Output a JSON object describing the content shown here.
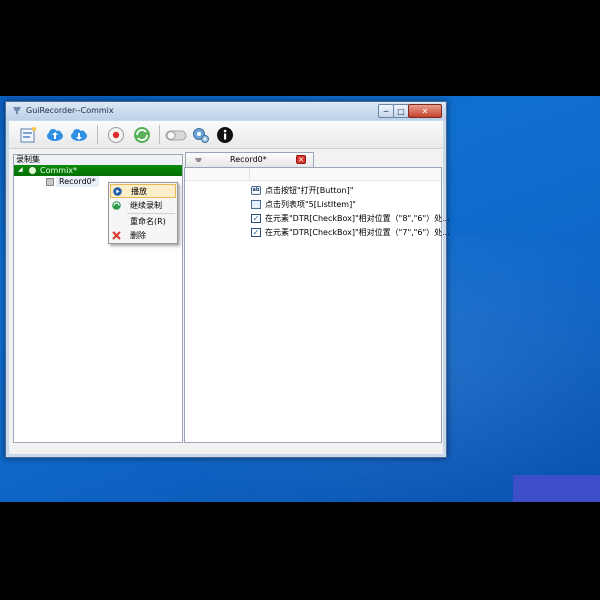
{
  "window": {
    "title": "GuiRecorder--Commix",
    "minimize_label": "─",
    "maximize_label": "□",
    "close_label": "✕"
  },
  "toolbar": {
    "buttons": [
      {
        "icon": "new-record-icon"
      },
      {
        "icon": "cloud-upload-icon"
      },
      {
        "icon": "cloud-download-icon"
      },
      {
        "icon": "record-button-icon"
      },
      {
        "icon": "refresh-icon"
      },
      {
        "icon": "toggle-switch-icon"
      },
      {
        "icon": "settings-gears-icon"
      },
      {
        "icon": "info-icon"
      }
    ]
  },
  "left_pane": {
    "header": "录制集",
    "root_expander": "◢",
    "root_label": "Commix*",
    "child_label": "Record0*"
  },
  "editor": {
    "tab_label": "Record0*",
    "tab_close": "✕",
    "rows": [
      {
        "icon": "ab-icon",
        "icon_text": "ab",
        "text": "点击按钮\"打开[Button]\""
      },
      {
        "icon": "list-item-icon",
        "icon_text": "",
        "text": "点击列表项\"5[ListItem]\""
      },
      {
        "icon": "checkbox-icon",
        "icon_text": "✓",
        "text": "在元素\"DTR[CheckBox]\"相对位置（\"8\",\"6\"）处..."
      },
      {
        "icon": "checkbox-icon",
        "icon_text": "✓",
        "text": "在元素\"DTR[CheckBox]\"相对位置（\"7\",\"6\"）处..."
      }
    ]
  },
  "context_menu": {
    "items": [
      {
        "label": "播放",
        "icon": "play-icon"
      },
      {
        "label": "继续录制",
        "icon": "continue-record-icon"
      },
      {
        "label": "重命名(R)",
        "icon": ""
      },
      {
        "label": "删除",
        "icon": "delete-icon"
      }
    ]
  },
  "colors": {
    "desktop": "#0f6fd0",
    "tree_selected": "#047004",
    "menu_highlight": "#fbeec9",
    "accent_red": "#d9382b"
  }
}
